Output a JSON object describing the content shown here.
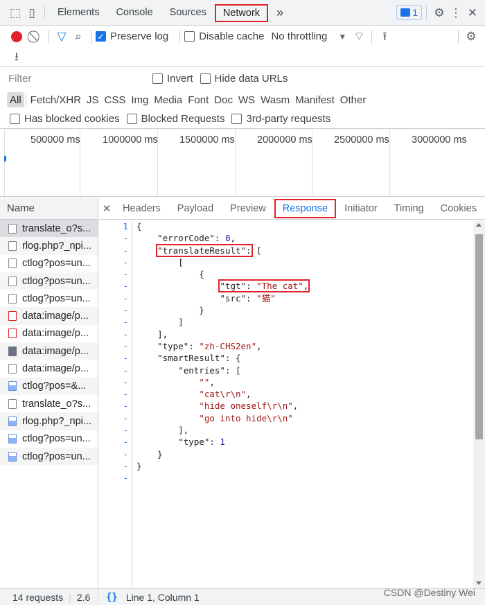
{
  "top_tabs": [
    "Elements",
    "Console",
    "Sources",
    "Network"
  ],
  "active_top_tab": "Network",
  "more_tabs_glyph": "»",
  "issues_badge_count": "1",
  "toolbar": {
    "preserve_log": "Preserve log",
    "disable_cache": "Disable cache",
    "throttling": "No throttling"
  },
  "filter": {
    "placeholder": "Filter",
    "invert": "Invert",
    "hide_data_urls": "Hide data URLs"
  },
  "type_filters": [
    "All",
    "Fetch/XHR",
    "JS",
    "CSS",
    "Img",
    "Media",
    "Font",
    "Doc",
    "WS",
    "Wasm",
    "Manifest",
    "Other"
  ],
  "blocked": {
    "has_blocked_cookies": "Has blocked cookies",
    "blocked_requests": "Blocked Requests",
    "third_party": "3rd-party requests"
  },
  "timeline_labels": [
    "500000 ms",
    "1000000 ms",
    "1500000 ms",
    "2000000 ms",
    "2500000 ms",
    "3000000 ms"
  ],
  "requests": {
    "header": "Name",
    "items": [
      {
        "name": "translate_o?s...",
        "icon": "doc"
      },
      {
        "name": "rlog.php?_npi...",
        "icon": "doc"
      },
      {
        "name": "ctlog?pos=un...",
        "icon": "doc"
      },
      {
        "name": "ctlog?pos=un...",
        "icon": "doc"
      },
      {
        "name": "ctlog?pos=un...",
        "icon": "doc"
      },
      {
        "name": "data:image/p...",
        "icon": "img-red"
      },
      {
        "name": "data:image/p...",
        "icon": "img-red"
      },
      {
        "name": "data:image/p...",
        "icon": "img-pic"
      },
      {
        "name": "data:image/p...",
        "icon": "doc"
      },
      {
        "name": "ctlog?pos=&...",
        "icon": "img-blue"
      },
      {
        "name": "translate_o?s...",
        "icon": "doc"
      },
      {
        "name": "rlog.php?_npi...",
        "icon": "img-blue"
      },
      {
        "name": "ctlog?pos=un...",
        "icon": "img-blue"
      },
      {
        "name": "ctlog?pos=un...",
        "icon": "img-blue"
      }
    ],
    "status": "14 requests",
    "status_size": "2.6"
  },
  "detail_tabs": [
    "Headers",
    "Payload",
    "Preview",
    "Response",
    "Initiator",
    "Timing",
    "Cookies"
  ],
  "active_detail_tab": "Response",
  "close_glyph": "✕",
  "gutter": [
    "1",
    "-",
    "-",
    "-",
    "-",
    "-",
    "-",
    "-",
    "-",
    "-",
    "-",
    "-",
    "-",
    "-",
    "-",
    "-",
    "-",
    "-",
    "-",
    "-",
    "-",
    "-"
  ],
  "code_lines": [
    "{",
    "    \"errorCode\": 0,",
    "    \"translateResult\": [",
    "        [",
    "            {",
    "                \"tgt\": \"The cat\",",
    "                \"src\": \"猫\"",
    "            }",
    "        ]",
    "    ],",
    "    \"type\": \"zh-CHS2en\",",
    "    \"smartResult\": {",
    "        \"entries\": [",
    "            \"\",",
    "            \"cat\\r\\n\",",
    "            \"hide oneself\\r\\n\",",
    "            \"go into hide\\r\\n\"",
    "        ],",
    "        \"type\": 1",
    "    }",
    "}"
  ],
  "position": "Line 1, Column 1",
  "format_glyph": "{}",
  "watermark": "CSDN @Destiny Wei"
}
